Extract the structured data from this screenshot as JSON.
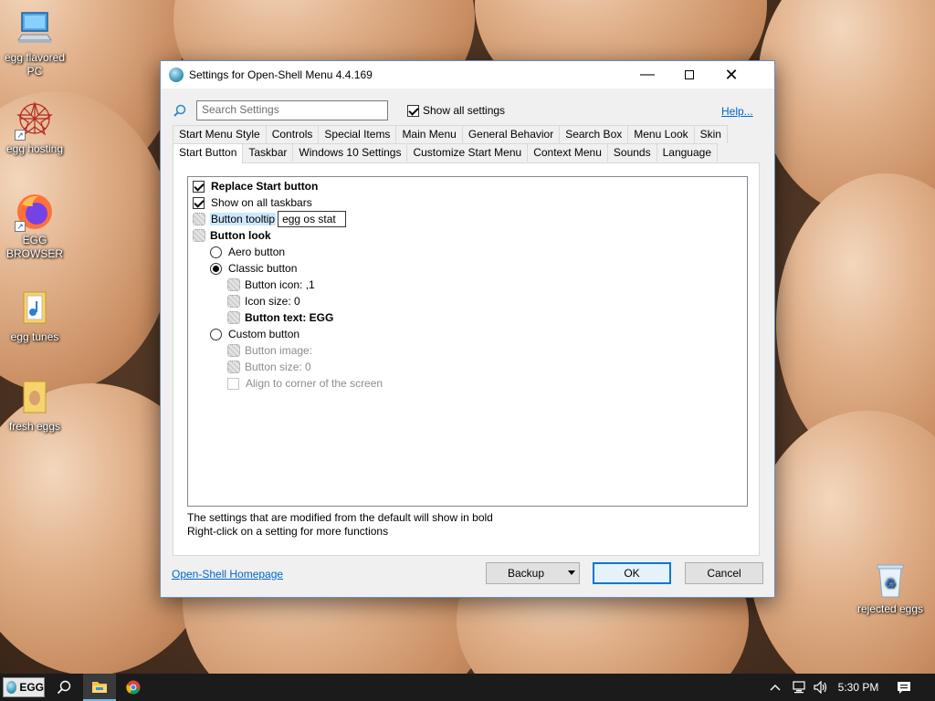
{
  "desktop": {
    "icons": [
      {
        "label": "egg flavored PC"
      },
      {
        "label": "egg hosting"
      },
      {
        "label": "EGG BROWSER"
      },
      {
        "label": "egg tunes"
      },
      {
        "label": "fresh eggs"
      },
      {
        "label": "rejected eggs"
      }
    ]
  },
  "dialog": {
    "title": "Settings for Open-Shell Menu 4.4.169",
    "search_placeholder": "Search Settings",
    "show_all_label": "Show all settings",
    "show_all_checked": true,
    "help_link": "Help...",
    "tabs_row1": [
      "Start Menu Style",
      "Controls",
      "Special Items",
      "Main Menu",
      "General Behavior",
      "Search Box",
      "Menu Look",
      "Skin"
    ],
    "tabs_row2": [
      "Start Button",
      "Taskbar",
      "Windows 10 Settings",
      "Customize Start Menu",
      "Context Menu",
      "Sounds",
      "Language"
    ],
    "active_tab": "Start Button",
    "settings": {
      "replace_start": "Replace Start button",
      "show_all_taskbars": "Show on all taskbars",
      "button_tooltip": "Button tooltip",
      "button_tooltip_value": "egg os stat",
      "button_look": "Button look",
      "aero_button": "Aero button",
      "classic_button": "Classic button",
      "button_icon": "Button icon: ,1",
      "icon_size": "Icon size: 0",
      "button_text": "Button text: EGG",
      "custom_button": "Custom button",
      "button_image": "Button image:",
      "button_size": "Button size: 0",
      "align_corner": "Align to corner of the screen"
    },
    "note_bold": "The settings that are modified from the default will show in bold",
    "note_rightclick": "Right-click on a setting for more functions",
    "homepage_link": "Open-Shell Homepage",
    "backup_label": "Backup",
    "ok_label": "OK",
    "cancel_label": "Cancel"
  },
  "taskbar": {
    "start_label": "EGG",
    "clock": "5:30 PM"
  }
}
